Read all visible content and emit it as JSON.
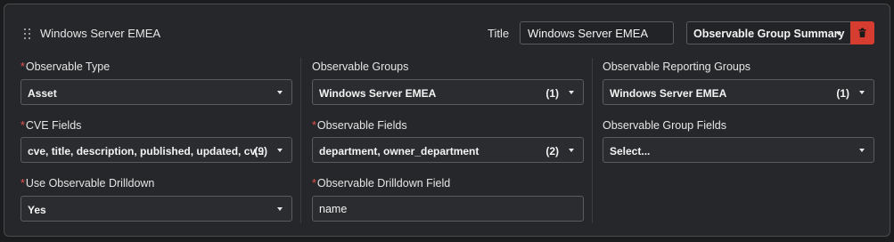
{
  "header": {
    "panel_title": "Windows Server EMEA",
    "title_label": "Title",
    "title_value": "Windows Server EMEA",
    "visualization_select": "Observable Group Summary"
  },
  "columns": [
    {
      "fields": [
        {
          "label": "Observable Type",
          "required": true,
          "value": "Asset",
          "count": ""
        },
        {
          "label": "CVE Fields",
          "required": true,
          "value": "cve, title, description, published, updated, cv...",
          "count": "(9)"
        },
        {
          "label": "Use Observable Drilldown",
          "required": true,
          "value": "Yes",
          "count": ""
        }
      ]
    },
    {
      "fields": [
        {
          "label": "Observable Groups",
          "required": false,
          "value": "Windows Server EMEA",
          "count": "(1)"
        },
        {
          "label": "Observable Fields",
          "required": true,
          "value": "department, owner_department",
          "count": "(2)"
        },
        {
          "label": "Observable Drilldown Field",
          "required": true,
          "value": "name"
        }
      ]
    },
    {
      "fields": [
        {
          "label": "Observable Reporting Groups",
          "required": false,
          "value": "Windows Server EMEA",
          "count": "(1)"
        },
        {
          "label": "Observable Group Fields",
          "required": false,
          "value": "Select...",
          "count": ""
        }
      ]
    }
  ],
  "colors": {
    "background": "#1b1c1e",
    "panel": "#26272a",
    "required_marker": "#e5534b",
    "delete_button": "#d63c2f"
  },
  "icons": {
    "drag": "drag-handle-icon",
    "delete": "trash-icon",
    "dropdown": "caret-down-icon"
  }
}
